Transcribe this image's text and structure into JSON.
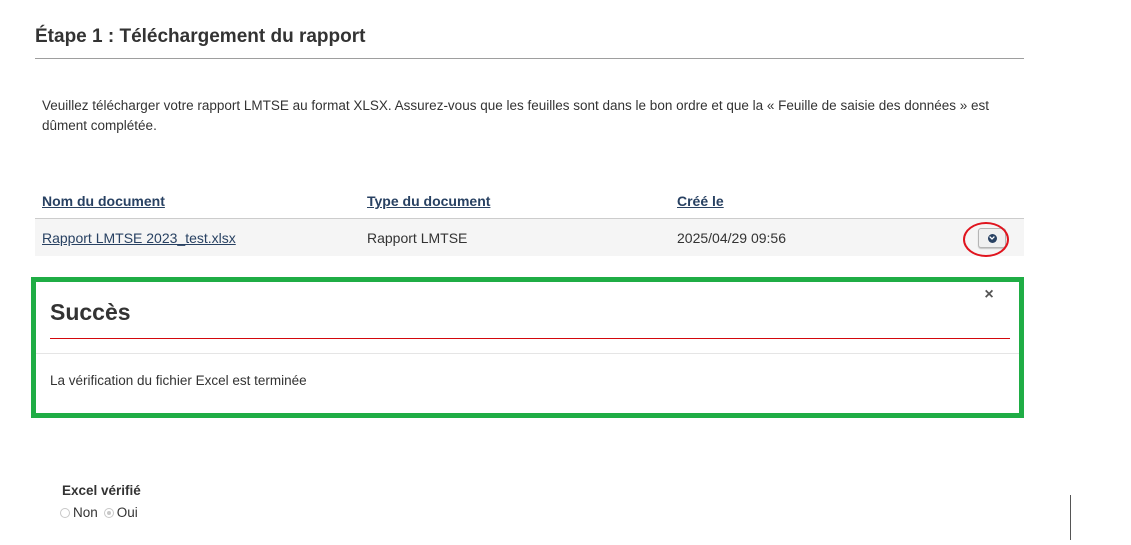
{
  "step": {
    "title": "Étape 1 : Téléchargement du rapport",
    "instructions": "Veuillez télécharger votre rapport LMTSE au format XLSX. Assurez-vous que les feuilles sont dans le bon ordre et que la « Feuille de saisie des données » est dûment complétée."
  },
  "table": {
    "headers": {
      "name": "Nom du document",
      "type": "Type du document",
      "created": "Créé le"
    },
    "rows": [
      {
        "name": "Rapport LMTSE 2023_test.xlsx",
        "type": "Rapport LMTSE",
        "created": "2025/04/29 09:56",
        "action_icon": "chevron-down-circle-icon"
      }
    ]
  },
  "success": {
    "title": "Succès",
    "message": "La vérification du fichier Excel est terminée",
    "close_symbol": "×"
  },
  "excel_verified": {
    "label": "Excel vérifié",
    "options": [
      {
        "label": "Non",
        "checked": false
      },
      {
        "label": "Oui",
        "checked": true
      }
    ],
    "disabled": true
  },
  "colors": {
    "link": "#284162",
    "success_border": "#1fad45",
    "highlight": "#e0141e",
    "title_rule": "#d3080c"
  }
}
